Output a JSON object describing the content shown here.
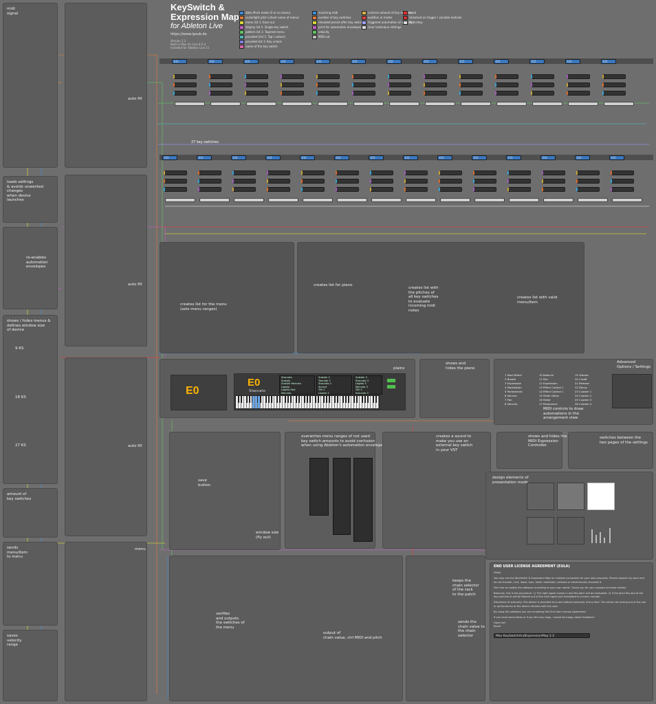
{
  "header": {
    "title_line1": "KeySwitch &",
    "title_line2": "Expression Map",
    "subtitle": "for Ableton Live",
    "url": "https://www.ipsub.de",
    "version": "Version 2.2\nBuilt in Max for Live 8.5.4\nInstalled for Ableton Live 11"
  },
  "legend": {
    "col1": [
      {
        "label": "data-/Push mode (0 or no menu)",
        "color": "#3f8bd6"
      },
      {
        "label": "scale/light pitch (sheet name of menu)",
        "color": "#e07b39"
      },
      {
        "label": "menu list 1: Ease out",
        "color": "#d8d83a"
      },
      {
        "label": "display list 1: Single key switch",
        "color": "#c060c0"
      },
      {
        "label": "pattern list 1: Tap/rest menu",
        "color": "#62c462"
      },
      {
        "label": "provided (list 1: Tap / unlock)",
        "color": "#52b8b8"
      },
      {
        "label": "provided list 1: Key unlock",
        "color": "#8080e0"
      },
      {
        "label": "name of the key switch",
        "color": "#dd66aa"
      }
    ],
    "col2": [
      {
        "label": "incoming midi",
        "color": "#3f8bd6"
      },
      {
        "label": "number of key switches",
        "color": "#e07b39"
      },
      {
        "label": "reloaded preset after key switch",
        "color": "#d8d83a"
      },
      {
        "label": "print for automation envelopes",
        "color": "#c060c0"
      },
      {
        "label": "velocity",
        "color": "#62c462"
      },
      {
        "label": "MIDI out",
        "color": "#bbbbbb"
      }
    ],
    "col3": [
      {
        "label": "controls amount of key switches",
        "color": "#d8b040"
      },
      {
        "label": "audition or mutes",
        "color": "#e04040"
      },
      {
        "label": "triggered automation of velocity",
        "color": "#a0a0ff"
      },
      {
        "label": "clear text/value settings",
        "color": "#dddddd"
      }
    ],
    "col4": [
      {
        "label": "bend",
        "color": "#e03030"
      },
      {
        "label": "Unlocked on trigger / variable textsize",
        "color": "#cc3333"
      },
      {
        "label": "Slider/key",
        "color": "#dddddd"
      }
    ]
  },
  "ks_row1": {
    "labels": [
      "EO",
      "EO",
      "EO",
      "EO",
      "EO",
      "EO",
      "EO",
      "EO",
      "EO",
      "EO",
      "EO",
      "EO",
      "EO"
    ]
  },
  "ks_section": {
    "title": "27 key switches",
    "row2_labels": [
      "EO",
      "EO",
      "EO",
      "EO",
      "EO",
      "EO",
      "EO",
      "EO",
      "EO",
      "EO",
      "EO",
      "EO",
      "EO",
      "EO"
    ]
  },
  "left_comments": {
    "midi_signal": "midi\nsignal",
    "loads_settings": "loads settings\n& avoids unwanted\nchanges\nwhen device\nlaunches",
    "reenables": "re-enables\nautomation\nenvelopes",
    "shows_hides": "shows / hides menus &\ndefines window size\nof device",
    "ks9": "9 KS",
    "ks18": "18 KS",
    "ks27": "27 KS",
    "amount": "amount of\nkey switches",
    "sends": "sends\nmenu/item\nto menu",
    "saves_range": "saves\nvelocity\nrange",
    "auto_fill_1": "auto fill",
    "auto_fill_2": "auto fill",
    "auto_fill_3": "auto fill",
    "menu": "menu"
  },
  "center_comments": {
    "creates_list_menu": "creates list for the menu\n(sets menu ranges)",
    "creates_list_piano": "creates list for piano",
    "creates_list_pitches": "creates list with\nthe pitches of\nall key switches\nto evaluate\nincoming midi\nnotes",
    "creates_list_valid": "creates list with valid\nmenu/item",
    "display": "display",
    "display_value": "E0",
    "device_value": "E0",
    "device_sub": "Staccato",
    "plains": "plains",
    "shows_hides_piano": "shows and\nhides the piano",
    "midi_controls": "MIDI controls to draw\nautomations in the\narrangement view",
    "advanced": "Advanced\nOptions / Settings",
    "overwrites": "overwrites menu ranges of not used\nkey switch amounts to avoid confusion\nwhen using Ableton's automation envelopes",
    "save_button": "save\nbutton",
    "window_size": "window size\n(fly out)",
    "creates_sound": "creates a sound to\nmake you use an\nexternal key switch\nin your VST",
    "shows_hides_midi": "shows and hides the\nMIDI Expression\nController",
    "switches_pages": "switches between the\ntwo pages of the settings",
    "design_elements": "design elements of\npresentation mode",
    "verifies": "verifies\nand outputs\nthe switches of\nthe menu",
    "output_chain": "output of\nchain value, ctrl MIDI and pitch",
    "keeps_chain": "keeps the\nchain selector\nof the rack\nto the patch",
    "sends_chain": "sends the\nchain value to\nthe chain\nselector"
  },
  "device_menu": {
    "col1": [
      "Staccato",
      "Sustain",
      "Sustain Marcato",
      "Legato",
      "Legato Fast",
      "Marcato",
      "Tremolo",
      "Trill",
      "Pizzicato",
      "Spiccato",
      "Harmonics"
    ],
    "col2": [
      "Sustain 2",
      "Tremolo 2",
      "Staccato 2",
      "Accent",
      "Trill 2",
      "Legato 2",
      "Marcato 2",
      "Overlay",
      "Flautando",
      "Col Legno",
      "Pizz Bartok"
    ],
    "col3": [
      "Sustain 3",
      "Staccato 3",
      "Legato 3",
      "Marcato 3",
      "Trill 3",
      "Spiccato 3",
      "Tremolo 3",
      "Harmonics 2",
      "Flautando 2"
    ]
  },
  "settings_list": {
    "col1": [
      "1 Mod Wheel",
      "2 Breath",
      "3 Expression",
      "4 Modulation",
      "5 Portamento",
      "6 Volume",
      "7 Pan",
      "8 Velocity"
    ],
    "col2": [
      "10 Balance",
      "11 Pan",
      "12 Expression",
      "13 Effect Control 1",
      "14 Effect Control 2",
      "15 Slider Delay",
      "16 Slider",
      "17 Resonance"
    ],
    "col3": [
      "19 Vibrato",
      "20 Cutoff",
      "21 Release",
      "22 Decay",
      "23 Custom 1",
      "24 Custom 2",
      "25 Custom 3",
      "26 Custom 4"
    ]
  },
  "eula": {
    "title": "END USER LICENSE AGREEMENT (EULA)",
    "greeting": "Hello!",
    "para1": "You may use the KeySwitch & Expression Map on multiple computers for your own purposes. Please respect my work and do not transfer, rent, lease, loan, resell, distribute, network or electronically transmit it.",
    "para2": "Feel free to modify the software according to your own needs. Thank you for your support and best wishes.",
    "para3": "Basically, this is the procedure: 1) The right signal comes in and the pitch will be evaluated. 2) If the pitch fits one of the key switches it will be filtered out of the midi signal and translated to a menu number.",
    "para4": "Disclaimer of warranty: The device is provided as is and without warranty of any kind. The entire risk arising out of the use or performance of the device remains with the user.",
    "para5": "By using this software you are accepting this End User License Agreement.",
    "para6": "If you have some ideas or if you find any bugs, I would be happy about feedback!",
    "thanks": "Have fun!",
    "sign": "Benol",
    "footer": "Max KeySwitchAndExpressionMap 2.2"
  }
}
